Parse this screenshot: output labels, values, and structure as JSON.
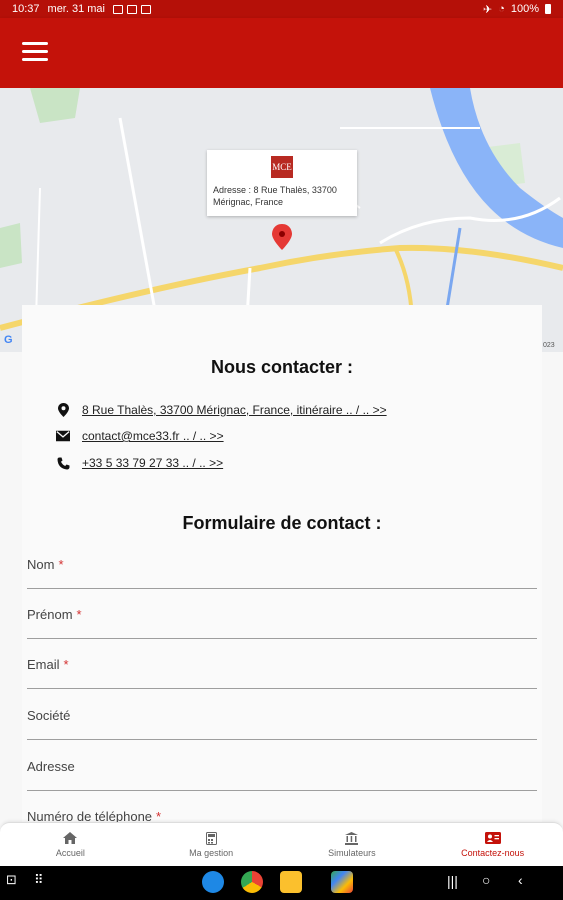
{
  "status_bar": {
    "time": "10:37",
    "date": "mer. 31 mai",
    "battery": "100%"
  },
  "app_bar": {
    "menu_icon": "hamburger-icon",
    "background": "#c4120a"
  },
  "map": {
    "popup_logo": "MCE",
    "popup_address": "Adresse : 8 Rue Thalès, 33700 Mérignac, France",
    "google_mark": "G",
    "copyright": "023"
  },
  "contact": {
    "title": "Nous contacter :",
    "address_link": "8 Rue Thalès, 33700 Mérignac, France, itinéraire .. / .. >>",
    "email_link": "contact@mce33.fr .. / .. >>",
    "phone_link": "+33 5 33 79 27 33 .. / .. >>"
  },
  "form": {
    "title": "Formulaire de contact :",
    "fields": [
      {
        "label": "Nom",
        "required": true
      },
      {
        "label": "Prénom",
        "required": true
      },
      {
        "label": "Email",
        "required": true
      },
      {
        "label": "Société",
        "required": false
      },
      {
        "label": "Adresse",
        "required": false
      },
      {
        "label": "Numéro de téléphone",
        "required": true
      }
    ],
    "required_mark": "*"
  },
  "bottom_nav": {
    "items": [
      {
        "label": "Accueil",
        "icon": "home-icon"
      },
      {
        "label": "Ma gestion",
        "icon": "calculator-icon"
      },
      {
        "label": "Simulateurs",
        "icon": "bank-icon"
      },
      {
        "label": "Contactez-nous",
        "icon": "contact-card-icon",
        "active": true
      }
    ]
  },
  "colors": {
    "brand": "#c4120a",
    "required": "#d32f2f"
  }
}
